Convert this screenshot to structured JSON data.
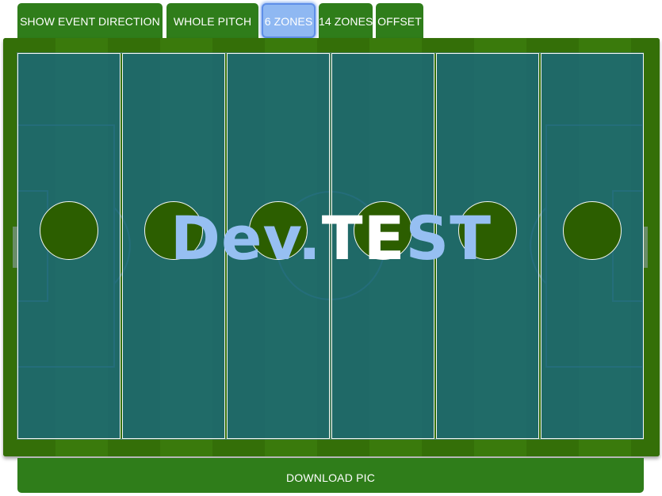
{
  "tabs": [
    {
      "label": "SHOW EVENT DIRECTION",
      "active": false
    },
    {
      "label": "WHOLE PITCH",
      "active": false
    },
    {
      "label": "6 ZONES",
      "active": true
    },
    {
      "label": "14 ZONES",
      "active": false
    },
    {
      "label": "OFFSET",
      "active": false
    }
  ],
  "pitch": {
    "zone_count": 6,
    "zone_color": "#1a6880",
    "grass_color": "#326f06",
    "circle_color": "#2c5e00",
    "line_color": "#f3f6f2"
  },
  "watermark": {
    "part_a": "Dev.",
    "part_b": "TE",
    "part_c": "ST"
  },
  "actions": {
    "download_label": "DOWNLOAD PIC"
  },
  "colors": {
    "button_green": "#2f7d1a",
    "active_tab": "#8fb8f2",
    "watermark_blue": "#96bff2"
  }
}
